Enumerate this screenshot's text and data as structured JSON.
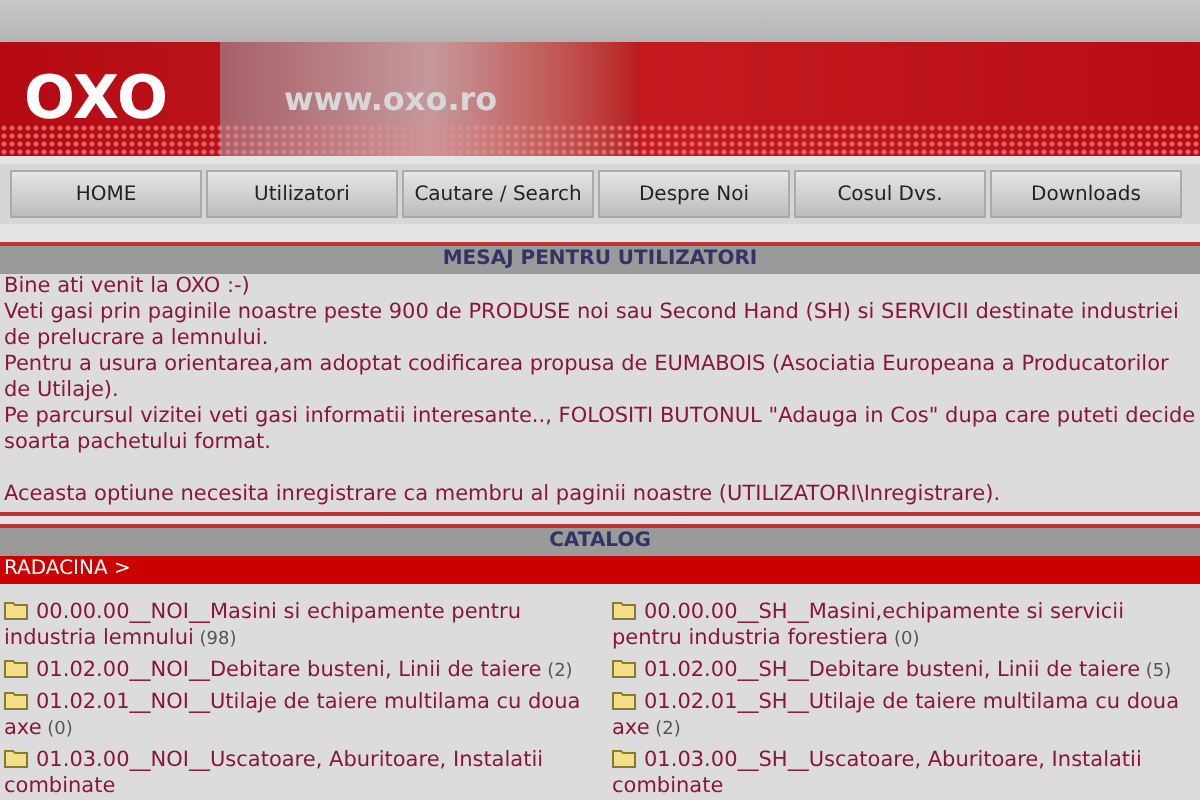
{
  "header": {
    "logo": "OXO",
    "url": "www.oxo.ro"
  },
  "nav": [
    {
      "label": "HOME"
    },
    {
      "label": "Utilizatori"
    },
    {
      "label": "Cautare / Search"
    },
    {
      "label": "Despre Noi"
    },
    {
      "label": "Cosul Dvs."
    },
    {
      "label": "Downloads"
    }
  ],
  "message": {
    "title": "MESAJ PENTRU UTILIZATORI",
    "paragraphs": [
      "Bine ati venit la OXO :-)",
      "Veti gasi prin paginile noastre peste 900 de PRODUSE noi sau Second Hand (SH) si SERVICII destinate industriei de prelucrare a lemnului.",
      "Pentru a usura orientarea,am adoptat codificarea propusa de EUMABOIS (Asociatia Europeana a Producatorilor de Utilaje).",
      "Pe parcursul vizitei veti gasi informatii interesante.., FOLOSITI BUTONUL \"Adauga in Cos\" dupa care puteti decide soarta pachetului format."
    ],
    "note": "Aceasta optiune necesita inregistrare ca membru al paginii noastre (UTILIZATORI\\Inregistrare)."
  },
  "catalog": {
    "title": "CATALOG",
    "breadcrumb": "RADACINA >",
    "columns": [
      [
        {
          "label": "00.00.00__NOI__Masini si echipamente pentru industria lemnului",
          "count": "(98)"
        },
        {
          "label": "01.02.00__NOI__Debitare busteni, Linii de taiere",
          "count": "(2)"
        },
        {
          "label": "01.02.01__NOI__Utilaje de taiere multilama cu doua axe",
          "count": "(0)"
        },
        {
          "label": "01.03.00__NOI__Uscatoare, Aburitoare, Instalatii combinate"
        }
      ],
      [
        {
          "label": "00.00.00__SH__Masini,echipamente si servicii pentru industria forestiera",
          "count": "(0)"
        },
        {
          "label": "01.02.00__SH__Debitare busteni, Linii de taiere",
          "count": "(5)"
        },
        {
          "label": "01.02.01__SH__Utilaje de taiere multilama cu doua axe",
          "count": "(2)"
        },
        {
          "label": "01.03.00__SH__Uscatoare, Aburitoare, Instalatii combinate"
        }
      ]
    ]
  }
}
